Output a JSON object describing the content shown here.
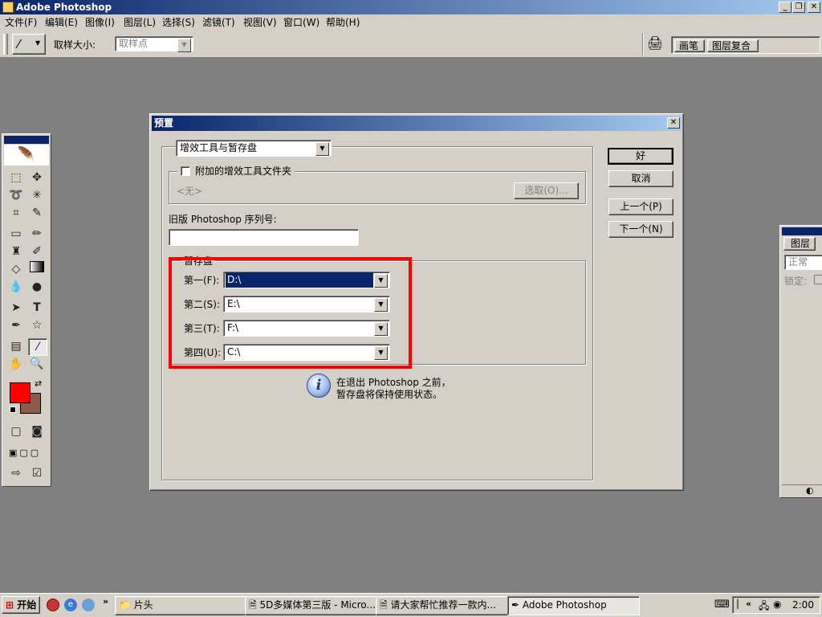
{
  "app": {
    "title": "Adobe Photoshop"
  },
  "menus": [
    "文件(F)",
    "编辑(E)",
    "图像(I)",
    "图层(L)",
    "选择(S)",
    "滤镜(T)",
    "视图(V)",
    "窗口(W)",
    "帮助(H)"
  ],
  "options_bar": {
    "sample_size_label": "取样大小:",
    "sample_size_value": "取样点",
    "palette_tabs": [
      "画笔",
      "图层复合"
    ]
  },
  "dialog": {
    "title": "预置",
    "section_dropdown": "增效工具与暂存盘",
    "plugins_checkbox_label": "附加的增效工具文件夹",
    "plugins_checked": false,
    "plugins_path": "<无>",
    "choose_button": "选取(O)...",
    "legacy_serial_label": "旧版 Photoshop 序列号:",
    "legacy_serial_value": "",
    "scratch_group_label": "暂存盘",
    "scratch_disks": [
      {
        "label": "第一(F):",
        "value": "D:\\"
      },
      {
        "label": "第二(S):",
        "value": "E:\\"
      },
      {
        "label": "第三(T):",
        "value": "F:\\"
      },
      {
        "label": "第四(U):",
        "value": "C:\\"
      }
    ],
    "info_text_line1": "在退出 Photoshop 之前，",
    "info_text_line2": "暂存盘将保持使用状态。",
    "buttons": {
      "ok": "好",
      "cancel": "取消",
      "prev": "上一个(P)",
      "next": "下一个(N)"
    },
    "highlight_color": "#ff0000"
  },
  "layers_panel": {
    "tab": "图层",
    "blend_mode": "正常",
    "lock_label": "锁定:"
  },
  "colors": {
    "foreground": "#ff0000",
    "background": "#8b5a4a"
  },
  "taskbar": {
    "start": "开始",
    "tasks": [
      "片头",
      "5D多媒体第三版 - Micro...",
      "请大家帮忙推荐一款内...",
      "Adobe Photoshop"
    ],
    "clock": "2:00"
  }
}
